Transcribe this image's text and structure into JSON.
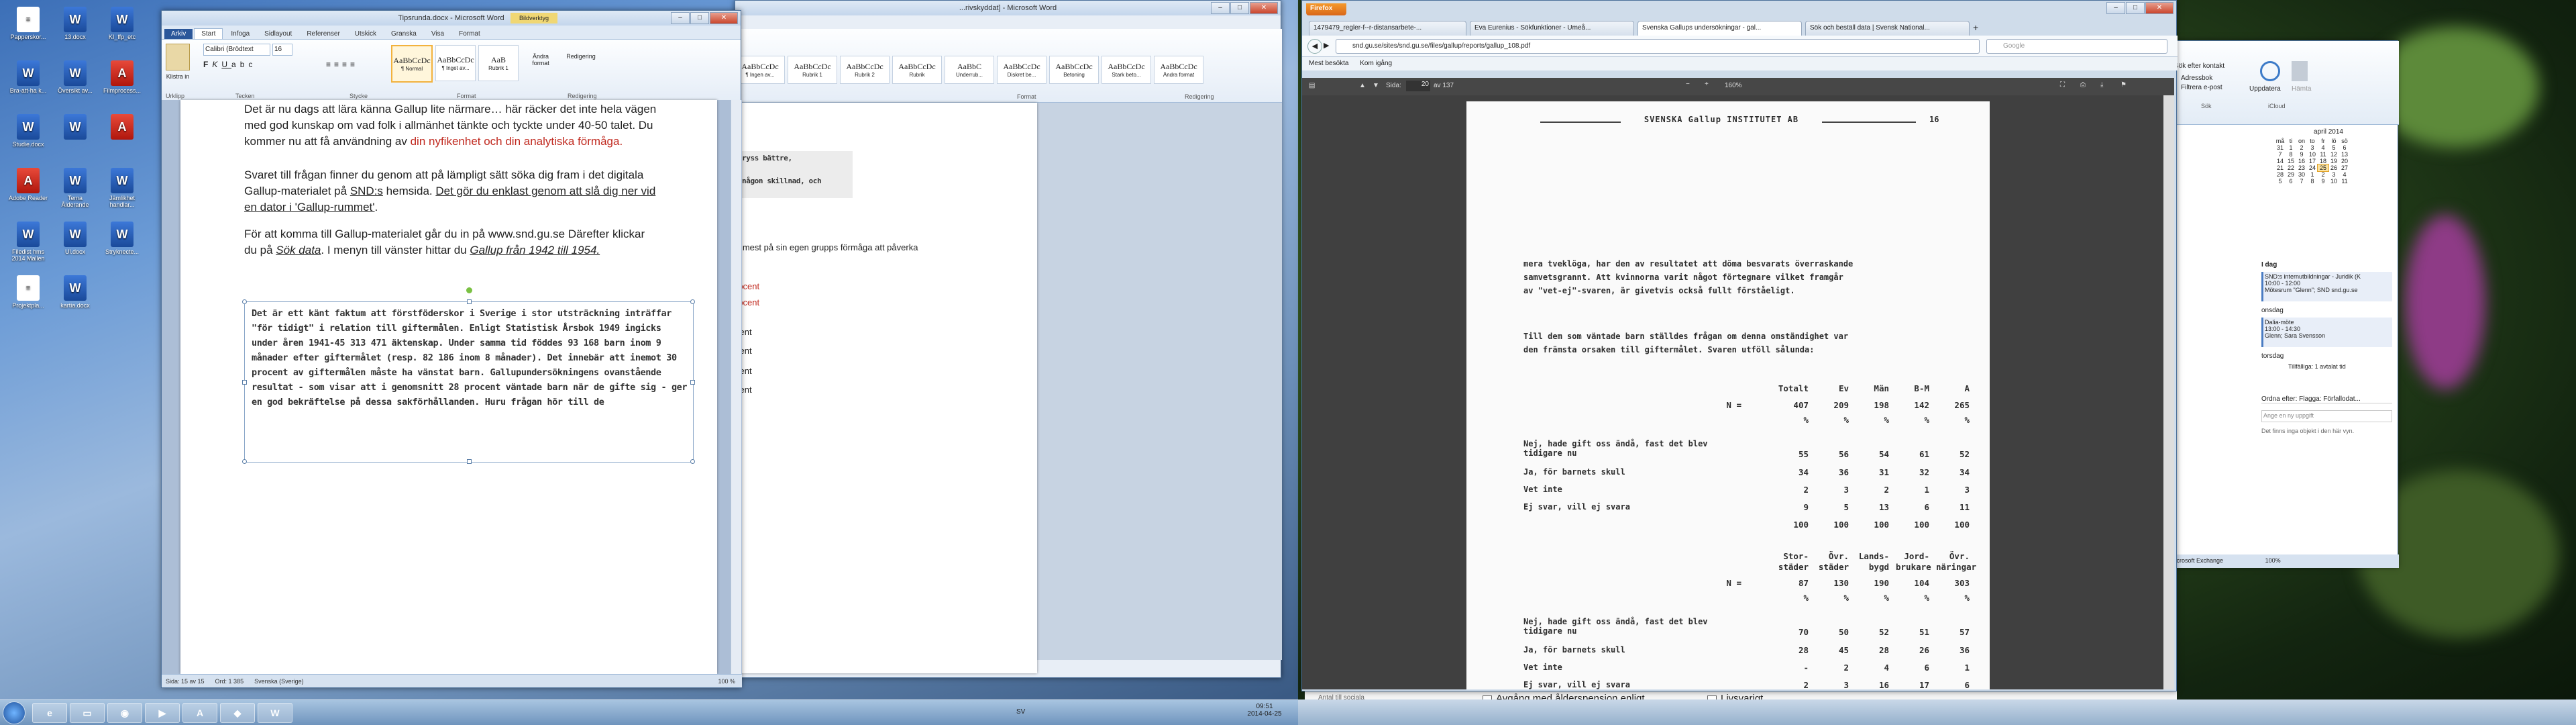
{
  "desktop_icons": [
    {
      "label": "Papperskor...",
      "kind": "doc"
    },
    {
      "label": "13.docx",
      "kind": "word"
    },
    {
      "label": "KI_ffp_etc",
      "kind": "word"
    },
    {
      "label": "Bra-att-ha k...",
      "kind": "word"
    },
    {
      "label": "Översikt av...",
      "kind": "word"
    },
    {
      "label": "Filmprocess...",
      "kind": "pdf"
    },
    {
      "label": "Studie.docx",
      "kind": "word"
    },
    {
      "label": "",
      "kind": "word"
    },
    {
      "label": "",
      "kind": "pdf"
    },
    {
      "label": "Adobe Reader",
      "kind": "pdf"
    },
    {
      "label": "Tema Ålderande",
      "kind": "word"
    },
    {
      "label": "Jämlikhet handlar...",
      "kind": "word"
    },
    {
      "label": "Filedist hms 2014 Mallen",
      "kind": "word"
    },
    {
      "label": "Ul.docx",
      "kind": "word"
    },
    {
      "label": "Stryknecte...",
      "kind": "word"
    },
    {
      "label": "Projektpla...",
      "kind": "doc"
    },
    {
      "label": "kartia.docx",
      "kind": "word"
    }
  ],
  "word": {
    "title": "Tipsrunda.docx - Microsoft Word",
    "context_tab": "Bildverktyg",
    "tabs": [
      "Arkiv",
      "Start",
      "Infoga",
      "Sidlayout",
      "Referenser",
      "Utskick",
      "Granska",
      "Visa",
      "Format"
    ],
    "font_name": "Calibri (Brödtext",
    "font_size": "16",
    "groups": [
      "Urklipp",
      "Tecken",
      "Stycke",
      "Format",
      "Redigering"
    ],
    "paste_label": "Klistra in",
    "styles": [
      {
        "sample": "AaBbCcDc",
        "name": "¶ Normal"
      },
      {
        "sample": "AaBbCcDc",
        "name": "¶ Inget av..."
      },
      {
        "sample": "AaB",
        "name": "Rubrik 1"
      }
    ],
    "change_styles": "Ändra format",
    "editing": "Redigering",
    "para1_a": "Det är nu dags att lära känna Gallup lite närmare… här räcker det inte hela vägen med god kunskap om vad folk i allmänhet tänkte och tyckte under 40-50 talet. Du kommer nu att få användning av ",
    "para1_red": "din nyfikenhet och din analytiska förmåga.",
    "para2_a": "Svaret till frågan finner du genom att på lämpligt sätt söka dig fram i det digitala Gallup-materialet  på ",
    "para2_snd": "SND:s",
    "para2_b": " hemsida. ",
    "para2_u": "Det gör du enklast genom att slå dig ner vid en dator i 'Gallup-rummet'",
    "para2_end": ".",
    "para3_a": "För att komma till Gallup-materialet  går du in på www.snd.gu.se Därefter klickar du på ",
    "para3_link1": "Sök data",
    "para3_b": ". I menyn till vänster hittar du ",
    "para3_link2": "Gallup från 1942 till 1954.",
    "image_text": "Det är ett känt faktum att förstföderskor i Sverige i stor utsträckning inträffar \"för tidigt\" i relation till giftermålen. Enligt Statistisk Årsbok 1949 ingicks under åren 1941-45 313 471 äktenskap. Under samma tid föddes 93 168 barn inom 9 månader efter giftermålet (resp. 82 186 inom 8 månader). Det innebär att inemot 30 procent av giftermålen måste ha vänstat barn. Gallupundersökningens ovanstående resultat - som visar att i genomsnitt 28 procent väntade barn när de gifte sig - ger en god bekräftelse på dessa sakförhållanden. Huru frågan hör till de",
    "status": [
      "Sida: 15 av 15",
      "Ord: 1 385",
      "Svenska (Sverige)"
    ],
    "zoom": "100 %"
  },
  "word2": {
    "title": "...rivskyddat] - Microsoft Word",
    "styles": [
      "AaBbCcDc",
      "AaBbCcDc",
      "AaBbCcDc",
      "AaBbCcDc",
      "AaBbC",
      "AaBbCcDc",
      "AaBbCcDc",
      "AaBbCcDc",
      "AaBbCcDc"
    ],
    "style_names": [
      "¶ Ingen av...",
      "Rubrik 1",
      "Rubrik 2",
      "Rubrik",
      "Underrub...",
      "Diskret be...",
      "Betoning",
      "Stark beto...",
      "Ändra format"
    ],
    "group_format": "Format",
    "group_red": "Redigering",
    "scan_lines": [
      "ryss bättre,",
      "någon skillnad, och"
    ],
    "side_text": "e mest på sin egen grupps förmåga att påverka",
    "side_q": "?",
    "proc": [
      "rocent",
      "rocent",
      "cent",
      "cent",
      "cent",
      "cent"
    ]
  },
  "firefox": {
    "app_label": "Firefox",
    "tabs": [
      "1479479_regler-f--r-distansarbete-...",
      "Eva Eurenius - Sökfunktioner - Umeå...",
      "Svenska Gallups undersökningar - gal...",
      "Sök och beställ data | Svensk National..."
    ],
    "url": "snd.gu.se/sites/snd.gu.se/files/gallup/reports/gallup_108.pdf",
    "search_placeholder": "Google",
    "bookmarks": [
      "Mest besökta",
      "Kom igång"
    ],
    "page_label": "Sida:",
    "page_num": "20",
    "page_total": "av 137",
    "zoom": "160%"
  },
  "pdf": {
    "header": "SVENSKA Gallup INSTITUTET AB",
    "page_no": "16",
    "p1": [
      "mera tveklöga, har den av resultatet att döma besvarats överraskande",
      "samvetsgrannt. Att kvinnorna varit något förtegnare vilket framgår",
      "av \"vet-ej\"-svaren, är givetvis också fullt förståeligt."
    ],
    "p2": [
      "Till dem som väntade barn ställdes frågan om denna omständighet var",
      "den främsta orsaken till giftermålet. Svaren utföll sålunda:"
    ],
    "t1_head": [
      "Totalt",
      "Ev",
      "Män",
      "B-M",
      "A"
    ],
    "t1_n": [
      "N =",
      "407",
      "209",
      "198",
      "142",
      "265"
    ],
    "t1_pct": [
      "%",
      "%",
      "%",
      "%",
      "%"
    ],
    "t1_rows": [
      {
        "label": "Nej, hade gift oss ändå, fast det blev tidigare nu",
        "vals": [
          "55",
          "56",
          "54",
          "61",
          "52"
        ]
      },
      {
        "label": "Ja, för barnets skull",
        "vals": [
          "34",
          "36",
          "31",
          "32",
          "34"
        ]
      },
      {
        "label": "Vet inte",
        "vals": [
          "2",
          "3",
          "2",
          "1",
          "3"
        ]
      },
      {
        "label": "Ej svar, vill ej svara",
        "vals": [
          "9",
          "5",
          "13",
          "6",
          "11"
        ]
      },
      {
        "label": "",
        "vals": [
          "100",
          "100",
          "100",
          "100",
          "100"
        ]
      }
    ],
    "t2_head1": [
      "Stor-",
      "Övr.",
      "Lands-",
      "Jord-",
      "Övr."
    ],
    "t2_head2": [
      "städer",
      "städer",
      "bygd",
      "brukare",
      "näringar"
    ],
    "t2_n": [
      "N =",
      "87",
      "130",
      "190",
      "104",
      "303"
    ],
    "t2_pct": [
      "%",
      "%",
      "%",
      "%",
      "%"
    ],
    "t2_rows": [
      {
        "label": "Nej, hade gift oss ändå, fast det blev tidigare nu",
        "vals": [
          "70",
          "50",
          "52",
          "51",
          "57"
        ]
      },
      {
        "label": "Ja, för barnets skull",
        "vals": [
          "28",
          "45",
          "28",
          "26",
          "36"
        ]
      },
      {
        "label": "Vet inte",
        "vals": [
          "-",
          "2",
          "4",
          "6",
          "1"
        ]
      },
      {
        "label": "Ej svar, vill ej svara",
        "vals": [
          "2",
          "3",
          "16",
          "17",
          "6"
        ]
      }
    ]
  },
  "outlook": {
    "search_contacts": "Sök efter kontakt",
    "address_book": "Adressbok",
    "filter_email": "Filtrera e-post",
    "search_label": "Sök",
    "update": "Uppdatera",
    "download": "Hämta",
    "icloud": "iCloud",
    "month": "april 2014",
    "weekdays": [
      "må",
      "ti",
      "on",
      "to",
      "fr",
      "lö",
      "sö"
    ],
    "weeks": [
      [
        "31",
        "1",
        "2",
        "3",
        "4",
        "5",
        "6"
      ],
      [
        "7",
        "8",
        "9",
        "10",
        "11",
        "12",
        "13"
      ],
      [
        "14",
        "15",
        "16",
        "17",
        "18",
        "19",
        "20"
      ],
      [
        "21",
        "22",
        "23",
        "24",
        "25",
        "26",
        "27"
      ],
      [
        "28",
        "29",
        "30",
        "1",
        "2",
        "3",
        "4"
      ],
      [
        "5",
        "6",
        "7",
        "8",
        "9",
        "10",
        "11"
      ]
    ],
    "today_label": "I dag",
    "appt1": [
      "SND:s internutbildningar - Juridik (K",
      "10:00 - 12:00",
      "Mötesrum \"Glenn\"; SND snd.gu.se"
    ],
    "tomorrow": "onsdag",
    "appt2": [
      "Dalia-möte",
      "13:00 - 14:30",
      "Glenn; Sara Svensson"
    ],
    "thursday": "torsdag",
    "thursday_note": "Tillfälliga: 1 avtalat tid",
    "order_label": "Ordna efter: Flagga: Förfallodat...",
    "task_placeholder": "Ange en ny uppgift",
    "no_items": "Det finns inga objekt i den här vyn.",
    "exchange": "Microsoft Exchange",
    "zoom": "100%"
  },
  "background_app": {
    "filter_label": "Antal till sociala",
    "checkbox1": "Avgång med ålderspension enligt övergångsbestämmelser",
    "checkbox2": "Livsvarigt"
  },
  "taskbar": {
    "time": "09:51",
    "date": "2014-04-25",
    "lang": "SV"
  }
}
